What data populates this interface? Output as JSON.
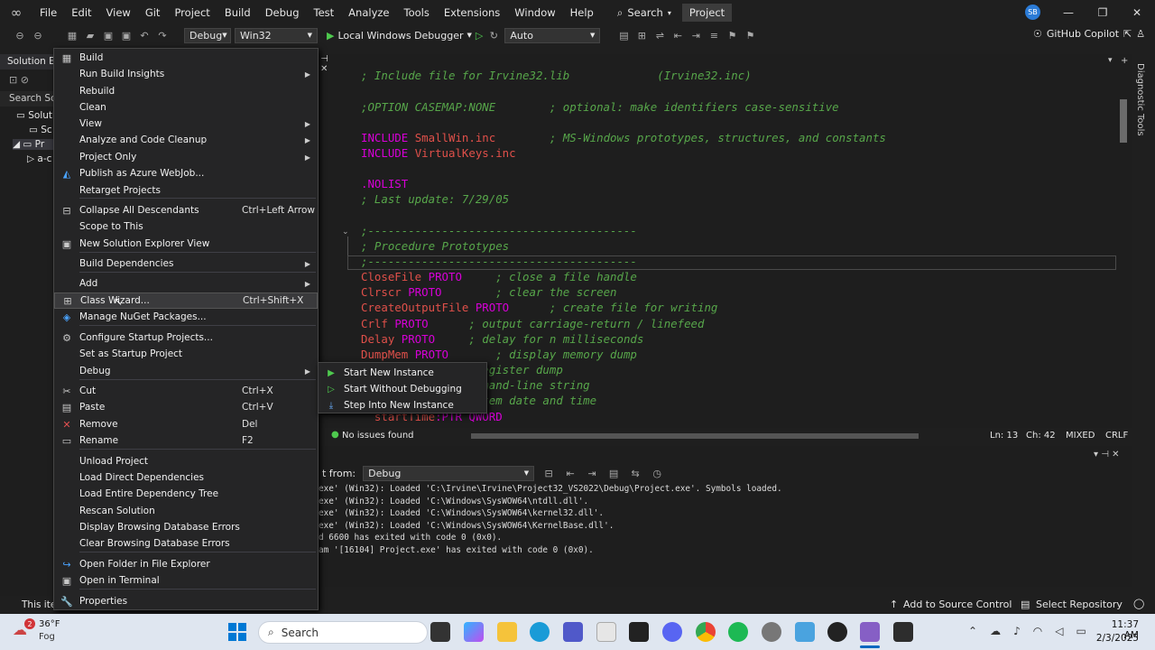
{
  "titlebar": {
    "menus": [
      "File",
      "Edit",
      "View",
      "Git",
      "Project",
      "Build",
      "Debug",
      "Test",
      "Analyze",
      "Tools",
      "Extensions",
      "Window",
      "Help"
    ],
    "search_label": "Search",
    "project_badge": "Project",
    "avatar_initials": "SB"
  },
  "toolbar": {
    "config": "Debug",
    "platform": "Win32",
    "debugger": "Local Windows Debugger",
    "auto": "Auto",
    "copilot": "GitHub Copilot"
  },
  "solution_explorer": {
    "title": "Solution Ex",
    "search": "Search Solu",
    "items": [
      "Soluti",
      "Sc",
      "Pr",
      "a-c"
    ],
    "status_text": "This iter"
  },
  "editor": {
    "code_lines": [
      {
        "kind": "cmt",
        "text": "; Include file for Irvine32.lib             (Irvine32.inc)"
      },
      {
        "kind": "cmt",
        "text": ";OPTION CASEMAP:NONE        ; optional: make identifiers case-sensitive"
      },
      {
        "kind": "inc",
        "kw": "INCLUDE ",
        "id": "SmallWin.inc",
        "cmt": "        ; MS-Windows prototypes, structures, and constants"
      },
      {
        "kind": "inc",
        "kw": "INCLUDE ",
        "id": "VirtualKeys.inc",
        "cmt": ""
      },
      {
        "kind": "kwline",
        "text": ".NOLIST"
      },
      {
        "kind": "cmt",
        "text": "; Last update: 7/29/05"
      },
      {
        "kind": "cmt",
        "text": ";----------------------------------------"
      },
      {
        "kind": "cmt",
        "text": "; Procedure Prototypes"
      },
      {
        "kind": "cmt",
        "text": ";----------------------------------------"
      },
      {
        "kind": "proto",
        "id": "CloseFile ",
        "kw": "PROTO",
        "cmt": "     ; close a file handle"
      },
      {
        "kind": "proto",
        "id": "Clrscr ",
        "kw": "PROTO",
        "cmt": "        ; clear the screen"
      },
      {
        "kind": "proto",
        "id": "CreateOutputFile ",
        "kw": "PROTO",
        "cmt": "      ; create file for writing"
      },
      {
        "kind": "proto",
        "id": "Crlf ",
        "kw": "PROTO",
        "cmt": "      ; output carriage-return / linefeed"
      },
      {
        "kind": "proto",
        "id": "Delay ",
        "kw": "PROTO",
        "cmt": "     ; delay for n milliseconds"
      },
      {
        "kind": "proto",
        "id": "DumpMem ",
        "kw": "PROTO",
        "cmt": "       ; display memory dump"
      },
      {
        "kind": "proto",
        "id": "",
        "kw": "",
        "cmt": "       ; display register dump"
      },
      {
        "kind": "proto",
        "id": "",
        "kw": "TO",
        "cmt": "       ; get command-line string"
      },
      {
        "kind": "proto",
        "id": "",
        "kw": "",
        "cmt": "         ; get system date and time"
      },
      {
        "kind": "proto",
        "id": "  startTime",
        "kw": ":PTR QWORD",
        "cmt": ""
      }
    ],
    "status": {
      "issues": "No issues found",
      "ln": "Ln: 13",
      "ch": "Ch: 42",
      "mode": "MIXED",
      "eol": "CRLF"
    }
  },
  "output": {
    "show_from_label": "t from:",
    "show_from_value": "Debug",
    "lines": [
      "exe' (Win32): Loaded 'C:\\Irvine\\Irvine\\Project32_VS2022\\Debug\\Project.exe'. Symbols loaded.",
      "exe' (Win32): Loaded 'C:\\Windows\\SysWOW64\\ntdll.dll'.",
      "exe' (Win32): Loaded 'C:\\Windows\\SysWOW64\\kernel32.dll'.",
      "exe' (Win32): Loaded 'C:\\Windows\\SysWOW64\\KernelBase.dll'.",
      "d 6600 has exited with code 0 (0x0).",
      "am '[16104] Project.exe' has exited with code 0 (0x0)."
    ]
  },
  "context_menu": {
    "items": [
      {
        "label": "Build",
        "icon": "build-icon",
        "shortcut": "",
        "arrow": false
      },
      {
        "label": "Run Build Insights",
        "icon": "",
        "shortcut": "",
        "arrow": true
      },
      {
        "label": "Rebuild",
        "icon": "",
        "shortcut": "",
        "arrow": false
      },
      {
        "label": "Clean",
        "icon": "",
        "shortcut": "",
        "arrow": false
      },
      {
        "label": "View",
        "icon": "",
        "shortcut": "",
        "arrow": true
      },
      {
        "label": "Analyze and Code Cleanup",
        "icon": "",
        "shortcut": "",
        "arrow": true
      },
      {
        "label": "Project Only",
        "icon": "",
        "shortcut": "",
        "arrow": true
      },
      {
        "label": "Publish as Azure WebJob...",
        "icon": "azure-icon",
        "shortcut": "",
        "arrow": false
      },
      {
        "label": "Retarget Projects",
        "icon": "",
        "shortcut": "",
        "arrow": false
      },
      {
        "label": "Collapse All Descendants",
        "icon": "collapse-icon",
        "shortcut": "Ctrl+Left Arrow",
        "arrow": false
      },
      {
        "label": "Scope to This",
        "icon": "",
        "shortcut": "",
        "arrow": false
      },
      {
        "label": "New Solution Explorer View",
        "icon": "new-view-icon",
        "shortcut": "",
        "arrow": false
      },
      {
        "label": "Build Dependencies",
        "icon": "",
        "shortcut": "",
        "arrow": true
      },
      {
        "label": "Add",
        "icon": "",
        "shortcut": "",
        "arrow": true
      },
      {
        "label": "Class Wizard...",
        "icon": "class-wizard-icon",
        "shortcut": "Ctrl+Shift+X",
        "arrow": false
      },
      {
        "label": "Manage NuGet Packages...",
        "icon": "nuget-icon",
        "shortcut": "",
        "arrow": false
      },
      {
        "label": "Configure Startup Projects...",
        "icon": "gear-icon",
        "shortcut": "",
        "arrow": false
      },
      {
        "label": "Set as Startup Project",
        "icon": "",
        "shortcut": "",
        "arrow": false
      },
      {
        "label": "Debug",
        "icon": "",
        "shortcut": "",
        "arrow": true
      },
      {
        "label": "Cut",
        "icon": "cut-icon",
        "shortcut": "Ctrl+X",
        "arrow": false
      },
      {
        "label": "Paste",
        "icon": "paste-icon",
        "shortcut": "Ctrl+V",
        "arrow": false
      },
      {
        "label": "Remove",
        "icon": "remove-icon",
        "shortcut": "Del",
        "arrow": false
      },
      {
        "label": "Rename",
        "icon": "rename-icon",
        "shortcut": "F2",
        "arrow": false
      },
      {
        "label": "Unload Project",
        "icon": "",
        "shortcut": "",
        "arrow": false
      },
      {
        "label": "Load Direct Dependencies",
        "icon": "",
        "shortcut": "",
        "arrow": false
      },
      {
        "label": "Load Entire Dependency Tree",
        "icon": "",
        "shortcut": "",
        "arrow": false
      },
      {
        "label": "Rescan Solution",
        "icon": "",
        "shortcut": "",
        "arrow": false
      },
      {
        "label": "Display Browsing Database Errors",
        "icon": "",
        "shortcut": "",
        "arrow": false
      },
      {
        "label": "Clear Browsing Database Errors",
        "icon": "",
        "shortcut": "",
        "arrow": false
      },
      {
        "label": "Open Folder in File Explorer",
        "icon": "folder-open-icon",
        "shortcut": "",
        "arrow": false
      },
      {
        "label": "Open in Terminal",
        "icon": "terminal-icon",
        "shortcut": "",
        "arrow": false
      },
      {
        "label": "Properties",
        "icon": "wrench-icon",
        "shortcut": "",
        "arrow": false
      }
    ],
    "hovered": "Class Wizard..."
  },
  "debug_submenu": {
    "items": [
      "Start New Instance",
      "Start Without Debugging",
      "Step Into New Instance"
    ]
  },
  "vs_status": {
    "add_source_control": "Add to Source Control",
    "select_repository": "Select Repository"
  },
  "taskbar": {
    "weather_temp": "36°F",
    "weather_desc": "Fog",
    "badge": "2",
    "search": "Search",
    "time": "11:37 AM",
    "date": "2/3/2025"
  }
}
